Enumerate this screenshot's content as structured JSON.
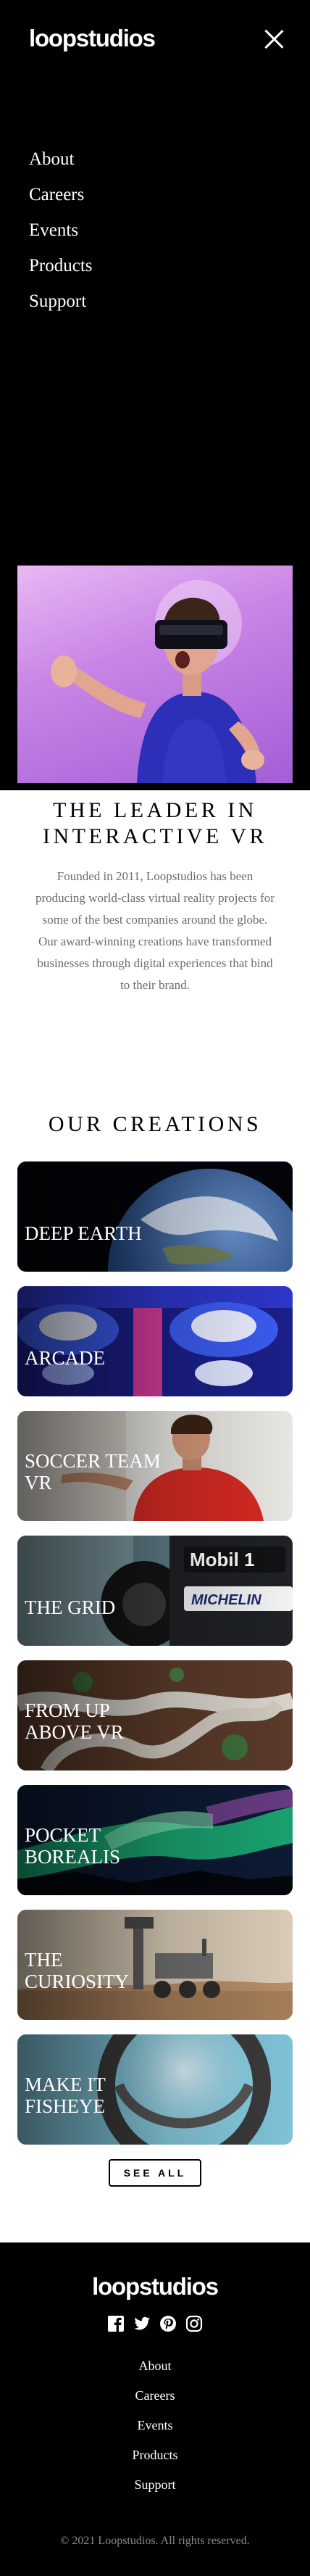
{
  "header": {
    "logo": "loopstudios"
  },
  "menu": {
    "items": [
      "About",
      "Careers",
      "Events",
      "Products",
      "Support"
    ]
  },
  "intro": {
    "title": "THE LEADER IN INTERACTIVE VR",
    "text": "Founded in 2011, Loopstudios has been producing world-class virtual reality projects for some of the best companies around the globe. Our award-winning creations have transformed businesses through digital experiences that bind to their brand."
  },
  "creations": {
    "heading": "OUR CREATIONS",
    "items": [
      "DEEP EARTH",
      "ARCADE",
      "SOCCER TEAM VR",
      "THE GRID",
      "FROM UP ABOVE VR",
      "POCKET BOREALIS",
      "THE CURIOSITY",
      "MAKE IT FISHEYE"
    ],
    "see_all": "SEE ALL"
  },
  "footer": {
    "logo": "loopstudios",
    "icons": [
      "facebook-icon",
      "twitter-icon",
      "pinterest-icon",
      "instagram-icon"
    ],
    "nav": [
      "About",
      "Careers",
      "Events",
      "Products",
      "Support"
    ],
    "copyright": "© 2021 Loopstudios. All rights reserved."
  }
}
